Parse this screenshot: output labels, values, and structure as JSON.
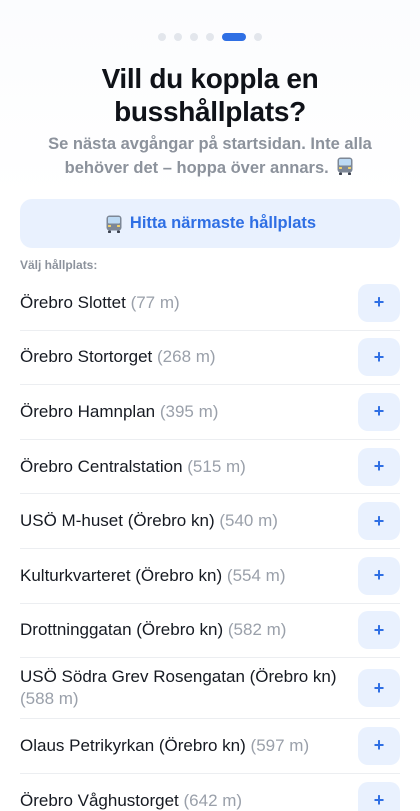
{
  "header": {
    "title": "Vill du koppla en busshållplats?",
    "subtitle": "Se nästa avgångar på startsidan. Inte alla behöver det – hoppa över annars.",
    "pagination": {
      "total": 6,
      "active_index": 4
    }
  },
  "find_button": {
    "label": "Hitta närmaste hållplats"
  },
  "section_label": "Välj hållplats:",
  "stops": [
    {
      "name": "Örebro Slottet",
      "distance": "(77 m)"
    },
    {
      "name": "Örebro Stortorget",
      "distance": "(268 m)"
    },
    {
      "name": "Örebro Hamnplan",
      "distance": "(395 m)"
    },
    {
      "name": "Örebro Centralstation",
      "distance": "(515 m)"
    },
    {
      "name": "USÖ M-huset (Örebro kn)",
      "distance": "(540 m)"
    },
    {
      "name": "Kulturkvarteret (Örebro kn)",
      "distance": "(554 m)"
    },
    {
      "name": "Drottninggatan (Örebro kn)",
      "distance": "(582 m)"
    },
    {
      "name": "USÖ Södra Grev Rosengatan (Örebro kn)",
      "distance": "(588 m)"
    },
    {
      "name": "Olaus Petrikyrkan (Örebro kn)",
      "distance": "(597 m)"
    },
    {
      "name": "Örebro Våghustorget",
      "distance": "(642 m)"
    }
  ],
  "add_button_glyph": "+",
  "icons": {
    "bus": "bus-icon",
    "add": "plus-icon"
  },
  "colors": {
    "accent": "#2f6fe4",
    "accent_bg": "#e9f1fe",
    "muted": "#8c929c"
  }
}
